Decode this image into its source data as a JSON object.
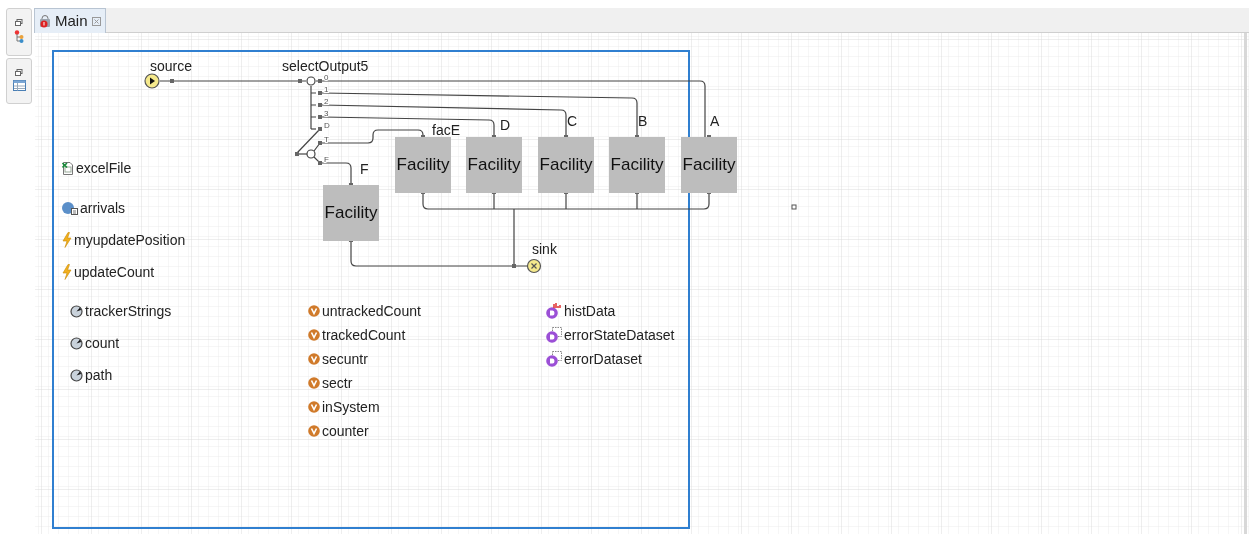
{
  "tabs": [
    {
      "label": "Main",
      "selected": true
    }
  ],
  "diagram": {
    "source": {
      "label": "source"
    },
    "select": {
      "label": "selectOutput5",
      "ports": [
        "0",
        "1",
        "2",
        "3",
        "D"
      ]
    },
    "select2": {
      "ports": [
        "T",
        "F"
      ]
    },
    "facilities": [
      {
        "name": "facE",
        "label": "Facility"
      },
      {
        "name": "D",
        "label": "Facility"
      },
      {
        "name": "C",
        "label": "Facility"
      },
      {
        "name": "B",
        "label": "Facility"
      },
      {
        "name": "A",
        "label": "Facility"
      },
      {
        "name": "F",
        "label": "Facility"
      }
    ],
    "sink": {
      "label": "sink"
    }
  },
  "elements": [
    {
      "kind": "excel",
      "name": "excelFile"
    },
    {
      "kind": "function",
      "name": "arrivals"
    },
    {
      "kind": "event",
      "name": "myupdatePosition"
    },
    {
      "kind": "event",
      "name": "updateCount"
    },
    {
      "kind": "collection",
      "name": "trackerStrings"
    },
    {
      "kind": "collection",
      "name": "count"
    },
    {
      "kind": "collection",
      "name": "path"
    },
    {
      "kind": "variable",
      "name": "untrackedCount"
    },
    {
      "kind": "variable",
      "name": "trackedCount"
    },
    {
      "kind": "variable",
      "name": "secuntr"
    },
    {
      "kind": "variable",
      "name": "sectr"
    },
    {
      "kind": "variable",
      "name": "inSystem"
    },
    {
      "kind": "variable",
      "name": "counter"
    },
    {
      "kind": "histogram",
      "name": "histData"
    },
    {
      "kind": "dataset",
      "name": "errorStateDataset"
    },
    {
      "kind": "dataset",
      "name": "errorDataset"
    }
  ]
}
